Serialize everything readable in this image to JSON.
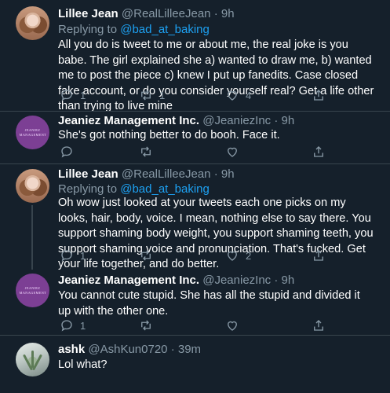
{
  "tweets": [
    {
      "name": "Lillee Jean",
      "handle": "@RealLilleeJean",
      "dot": "·",
      "time": "9h",
      "replying_prefix": "Replying to ",
      "replying_mention": "@bad_at_baking",
      "text": "All you do is tweet to me or about me, the real joke is you babe. The girl explained she a) wanted to draw me, b) wanted me to post the piece c) knew I put up fanedits. Case closed fake account, or do you consider yourself real? Get a life other than trying to live mine",
      "reply_count": "1",
      "retweet_count": "1",
      "like_count": "4"
    },
    {
      "name": "Jeaniez Management Inc.",
      "handle": "@JeaniezInc",
      "dot": "·",
      "time": "9h",
      "avatar_text": "JEANIEZ MANAGEMENT",
      "text": "She's got nothing better to do booh. Face it.",
      "reply_count": "",
      "retweet_count": "",
      "like_count": ""
    },
    {
      "name": "Lillee Jean",
      "handle": "@RealLilleeJean",
      "dot": "·",
      "time": "9h",
      "replying_prefix": "Replying to ",
      "replying_mention": "@bad_at_baking",
      "text": "Oh wow just looked at your tweets each one picks on my looks, hair, body, voice. I mean, nothing else to say there. You support shaming body weight, you support shaming teeth, you support shaming voice and pronunciation. That's fucked. Get your life together, and do better.",
      "reply_count": "1",
      "retweet_count": "",
      "like_count": "2"
    },
    {
      "name": "Jeaniez Management Inc.",
      "handle": "@JeaniezInc",
      "dot": "·",
      "time": "9h",
      "avatar_text": "JEANIEZ MANAGEMENT",
      "text": "You cannot cute stupid. She has all the stupid and divided it up with the other one.",
      "reply_count": "1",
      "retweet_count": "",
      "like_count": ""
    },
    {
      "name": "ashk",
      "handle": "@AshKun0720",
      "dot": "·",
      "time": "39m",
      "text": "Lol what?"
    }
  ],
  "icons": {
    "reply": "reply-icon",
    "retweet": "retweet-icon",
    "like": "heart-icon",
    "share": "share-icon"
  },
  "colors": {
    "background": "#15202b",
    "secondary_text": "#8899a6",
    "link": "#1da1f2",
    "separator": "#38444d"
  }
}
